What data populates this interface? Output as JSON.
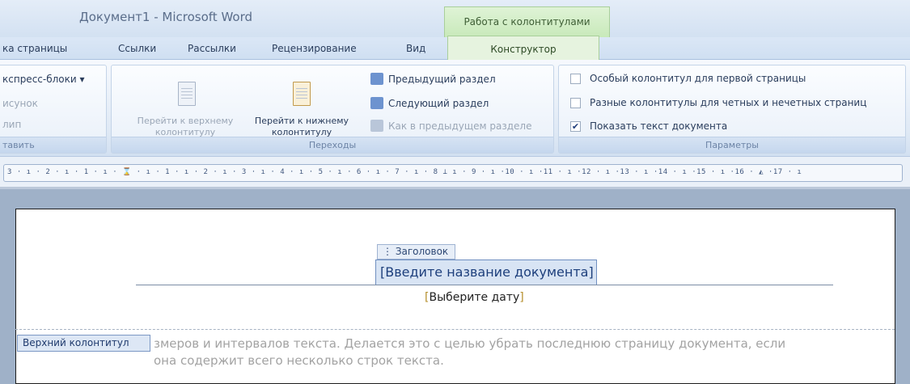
{
  "window": {
    "title": "Документ1 - Microsoft Word",
    "context_header": "Работа с колонтитулами"
  },
  "tabs": {
    "page_layout": "ка страницы",
    "references": "Ссылки",
    "mailings": "Рассылки",
    "review": "Рецензирование",
    "view": "Вид",
    "design": "Конструктор"
  },
  "ribbon": {
    "insert_group": {
      "express_blocks": "кспресс-блоки ▾",
      "picture": "исунок",
      "clip": "лип",
      "label": "тавить"
    },
    "navigation_group": {
      "goto_header_line1": "Перейти к верхнему",
      "goto_header_line2": "колонтитулу",
      "goto_footer_line1": "Перейти к нижнему",
      "goto_footer_line2": "колонтитулу",
      "prev_section": "Предыдущий раздел",
      "next_section": "Следующий раздел",
      "link_to_previous": "Как в предыдущем разделе",
      "label": "Переходы"
    },
    "options_group": {
      "different_first_page": "Особый колонтитул для первой страницы",
      "different_odd_even": "Разные колонтитулы для четных и нечетных страниц",
      "show_document_text": "Показать текст документа",
      "label": "Параметры"
    }
  },
  "ruler": {
    "text": "3 · ı · 2 · ı · 1 · ı · ⌛ · ı · 1 · ı · 2 · ı · 3 · ı · 4 · ı · 5 · ı · 6 · ı · 7 · ı · 8 ⊥ ı · 9 · ı ·10 · ı ·11 · ı ·12 · ı ·13 · ı ·14 · ı ·15 · ı ·16 · ◭ ·17 · ı"
  },
  "document": {
    "title_tag": "⋮ Заголовок",
    "title_placeholder": "[Введите название документа]",
    "date_open": "[",
    "date_text": "Выберите дату",
    "date_close": "]",
    "header_label": "Верхний колонтитул",
    "body_line1": "змеров и интервалов текста. Делается это с целью убрать последнюю страницу документа, если",
    "body_line2": "она содержит всего несколько строк текста."
  },
  "checkbox_states": {
    "different_first_page": false,
    "different_odd_even": false,
    "show_document_text": true
  },
  "colors": {
    "context_tab": "#c8e9ba",
    "ribbon_blue": "#dfe9f5",
    "doc_background": "#9fb1c8"
  }
}
